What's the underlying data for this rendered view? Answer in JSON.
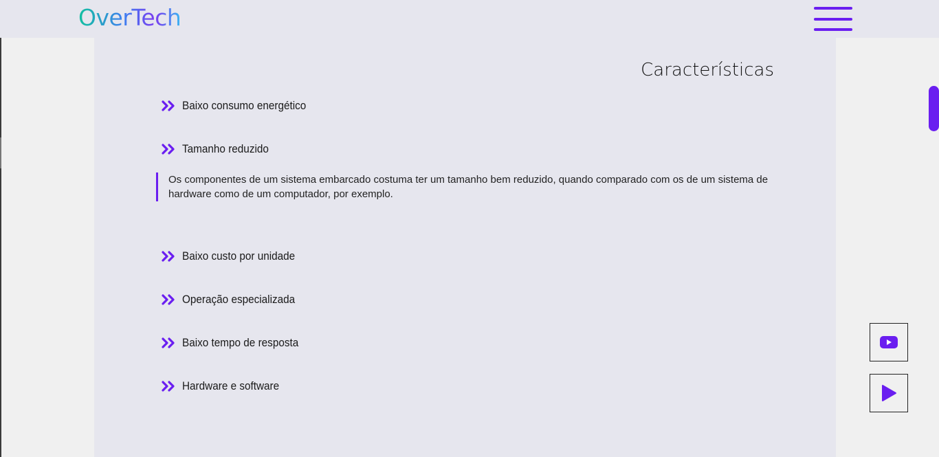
{
  "header": {
    "logo_text": "OverTech",
    "menu_icon": "hamburger-menu-icon"
  },
  "main": {
    "section_title": "Características",
    "features": [
      {
        "label": "Baixo consumo energético",
        "icon": "double-chevron-right-icon"
      },
      {
        "label": "Tamanho reduzido",
        "icon": "double-chevron-right-icon",
        "expanded": true
      },
      {
        "label": "Baixo custo por unidade",
        "icon": "double-chevron-right-icon"
      },
      {
        "label": "Operação especializada",
        "icon": "double-chevron-right-icon"
      },
      {
        "label": "Baixo tempo de resposta",
        "icon": "double-chevron-right-icon"
      },
      {
        "label": "Hardware e software",
        "icon": "double-chevron-right-icon"
      }
    ],
    "expanded_description": "Os componentes de um sistema embarcado costuma ter um tamanho bem reduzido, quando comparado com os de um sistema de hardware como de um computador, por exemplo."
  },
  "side_buttons": [
    {
      "icon": "youtube-icon"
    },
    {
      "icon": "play-icon"
    }
  ],
  "colors": {
    "accent": "#6a1ef0",
    "panel_bg": "#e6e6ee",
    "page_bg": "#f0f0f0"
  }
}
